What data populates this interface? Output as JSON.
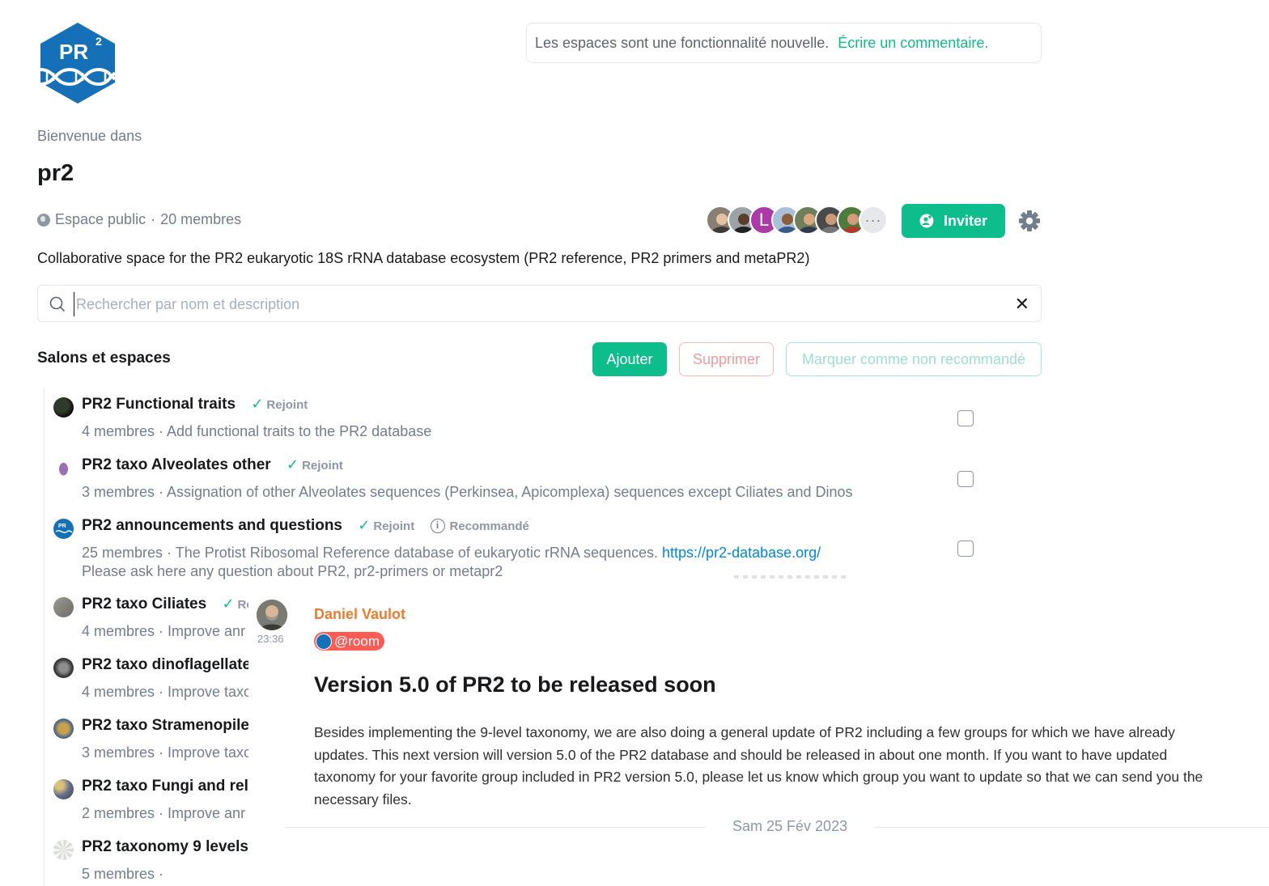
{
  "logo": {
    "text": "PR",
    "superscript": "2"
  },
  "notice": {
    "text": "Les espaces sont une fonctionnalité nouvelle.",
    "link": "Écrire un commentaire."
  },
  "header": {
    "welcome": "Bienvenue dans",
    "space_name": "pr2",
    "visibility": "Espace public",
    "separator": "·",
    "members": "20 membres",
    "description": "Collaborative space for the PR2 eukaryotic 18S rRNA database ecosystem (PR2 reference, PR2 primers and metaPR2)"
  },
  "members_avatars": {
    "letter": "L",
    "more": "···"
  },
  "actions": {
    "invite": "Inviter"
  },
  "search": {
    "placeholder": "Rechercher par nom et description",
    "value": "",
    "clear": "✕"
  },
  "rooms_section": {
    "title": "Salons et espaces",
    "add": "Ajouter",
    "delete": "Supprimer",
    "unrecommend": "Marquer comme non recommandé"
  },
  "rooms": [
    {
      "name": "PR2 Functional traits",
      "joined": "Rejoint",
      "desc": "4 membres · Add functional traits to the PR2 database"
    },
    {
      "name": "PR2 taxo Alveolates other",
      "joined": "Rejoint",
      "desc": "3 membres · Assignation of other Alveolates sequences (Perkinsea, Apicomplexa) sequences except Ciliates and Dinos"
    },
    {
      "name": "PR2 announcements and questions",
      "joined": "Rejoint",
      "info": "i",
      "recommended": "Recommandé",
      "desc": "25 membres · The Protist Ribosomal Reference database of eukaryotic rRNA sequences.",
      "link": "https://pr2-database.org/",
      "desc2": "Please ask here any question about PR2, pr2-primers or metapr2"
    },
    {
      "name": "PR2 taxo Ciliates",
      "joined": "Re",
      "desc": "4 membres · Improve anr"
    },
    {
      "name": "PR2 taxo dinoflagellate",
      "desc": "4 membres · Improve taxo"
    },
    {
      "name": "PR2 taxo Stramenopile",
      "desc": "3 membres · Improve taxo"
    },
    {
      "name": "PR2 taxo Fungi and rela",
      "desc": "2 membres · Improve anr"
    },
    {
      "name": "PR2 taxonomy 9 levels",
      "desc": "5 membres ·"
    }
  ],
  "message": {
    "sender": "Daniel Vaulot",
    "time": "23:36",
    "mention": "@room",
    "title": "Version 5.0 of PR2 to be released soon",
    "body": "Besides implementing the 9-level taxonomy, we are also doing a general update of PR2 including a few groups for which we have already updates. This next version will version 5.0 of the PR2 database and should be released in about one month. If you want to have updated taxonomy for your favorite group included in PR2 version 5.0, please let us know which group you want to update so that we can send you the necessary files."
  },
  "date_separator": "Sam 25 Fév 2023",
  "colors": {
    "accent": "#0dbd8b",
    "danger": "#ff5b55",
    "sender": "#ee7b2d",
    "link": "#0086e6",
    "logo": "#1670b8"
  }
}
